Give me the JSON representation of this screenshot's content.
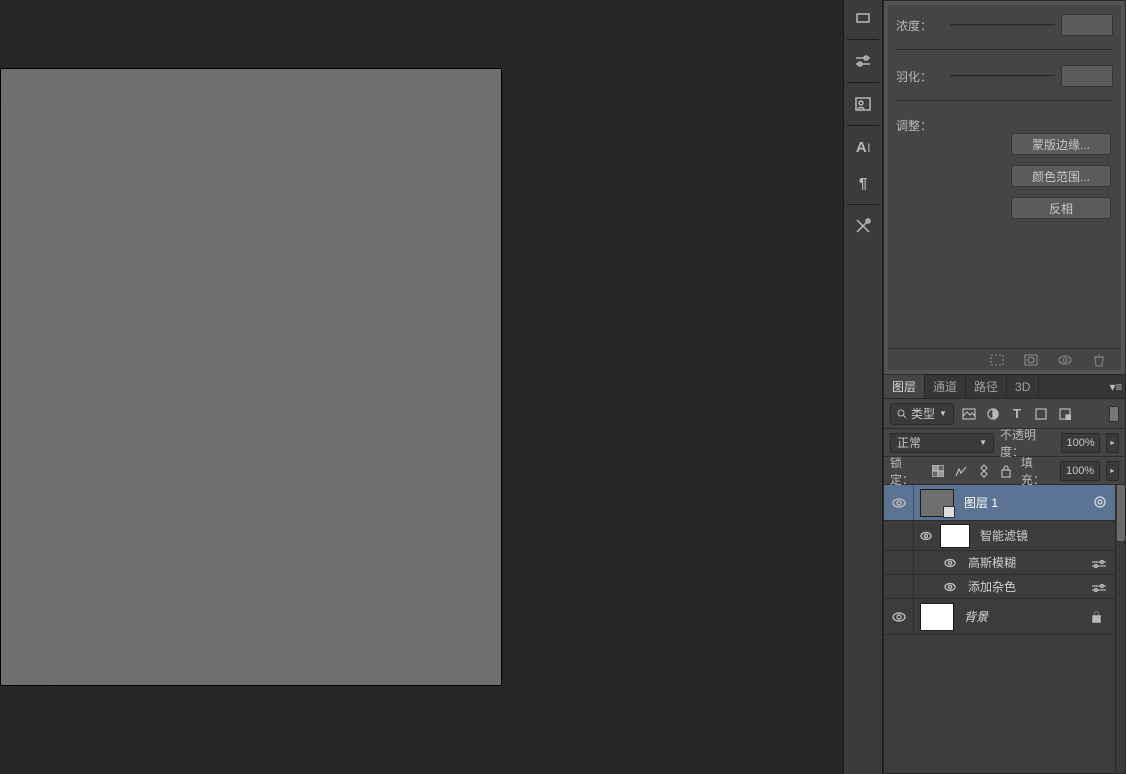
{
  "mask_panel": {
    "density_label": "浓度：",
    "feather_label": "羽化：",
    "adjust_label": "调整：",
    "mask_edge_btn": "蒙版边缘...",
    "color_range_btn": "颜色范围...",
    "invert_btn": "反相"
  },
  "layers_panel": {
    "tabs": [
      "图层",
      "通道",
      "路径",
      "3D"
    ],
    "kind_label": "类型",
    "blend_mode": "正常",
    "opacity_label": "不透明度：",
    "opacity_value": "100%",
    "lock_label": "锁定：",
    "fill_label": "填充：",
    "fill_value": "100%",
    "layers": [
      {
        "name": "图层 1",
        "selected": true,
        "smart": true
      },
      {
        "name": "智能滤镜",
        "is_filter_header": true
      },
      {
        "name": "高斯模糊",
        "is_filter_item": true
      },
      {
        "name": "添加杂色",
        "is_filter_item": true
      },
      {
        "name": "背景",
        "locked": true,
        "italic": true,
        "white": true
      }
    ]
  }
}
